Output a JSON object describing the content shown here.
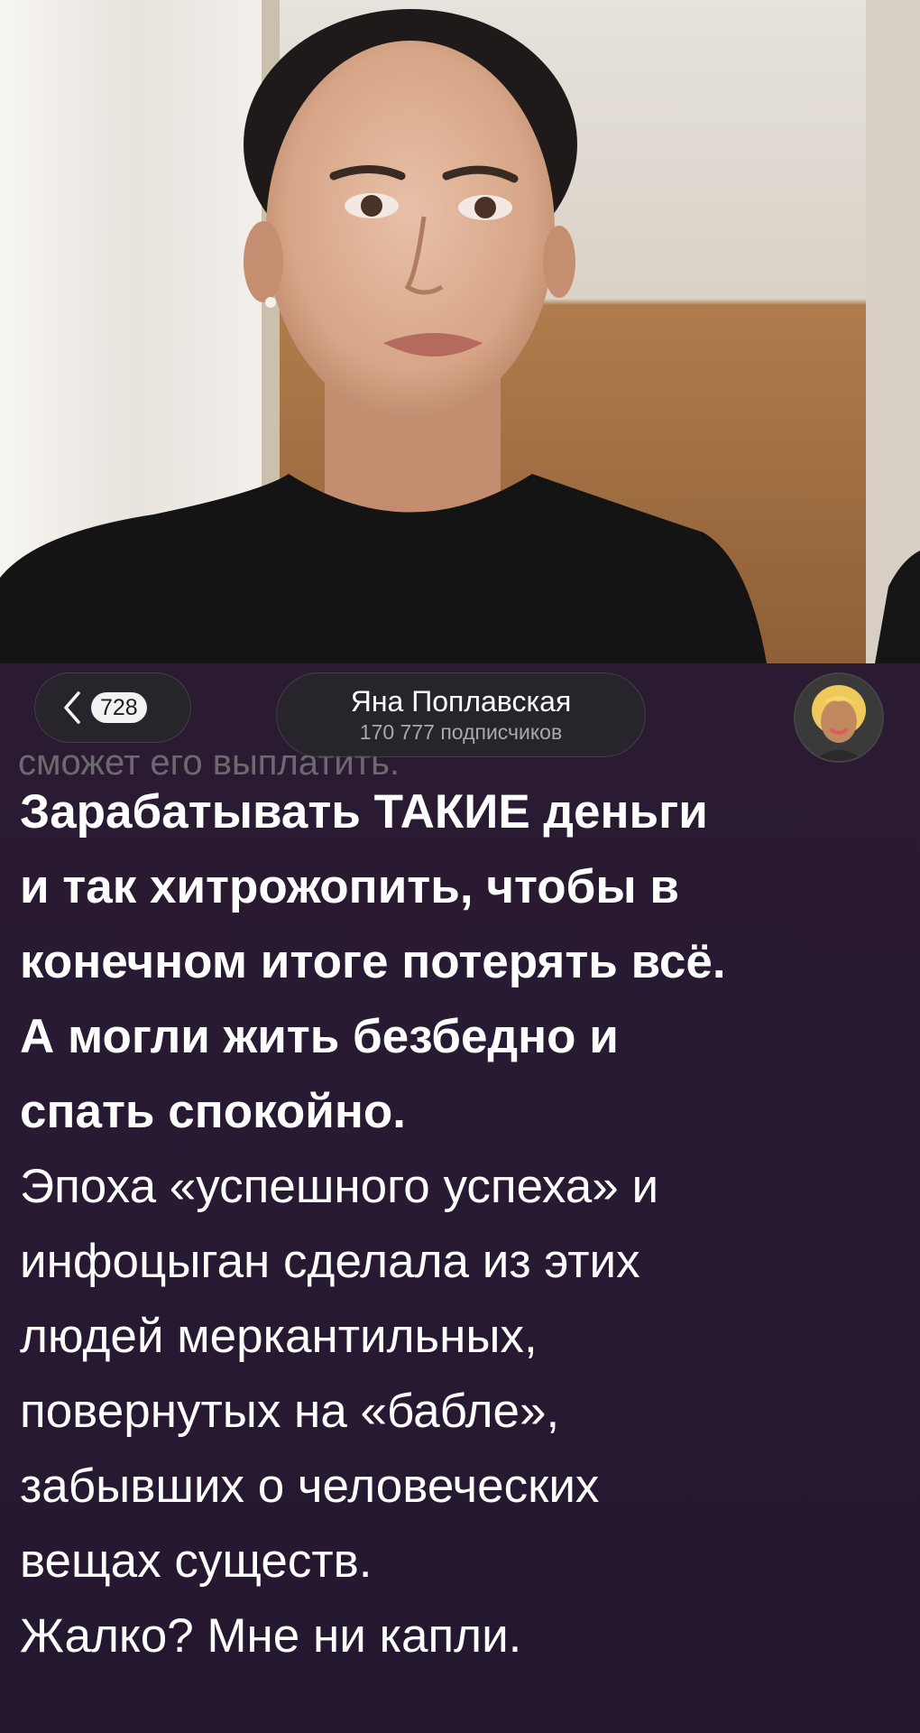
{
  "header": {
    "back_count": "728",
    "channel_name": "Яна Поплавская",
    "subscribers": "170 777 подписчиков",
    "overlay_text": "сможет его выплатить."
  },
  "post": {
    "bold_lines": [
      "Зарабатывать ТАКИЕ деньги",
      "и так хитрожопить, чтобы в",
      "конечном итоге потерять всё.",
      "А могли жить безбедно и",
      "спать спокойно."
    ],
    "regular_lines": [
      "Эпоха «успешного успеха» и",
      "инфоцыган сделала из этих",
      "людей меркантильных,",
      "повернутых на «бабле»,",
      "забывших о человеческих",
      "вещах существ.",
      "Жалко? Мне ни капли."
    ]
  },
  "icons": {
    "back": "chevron-left-icon",
    "avatar": "channel-avatar"
  }
}
